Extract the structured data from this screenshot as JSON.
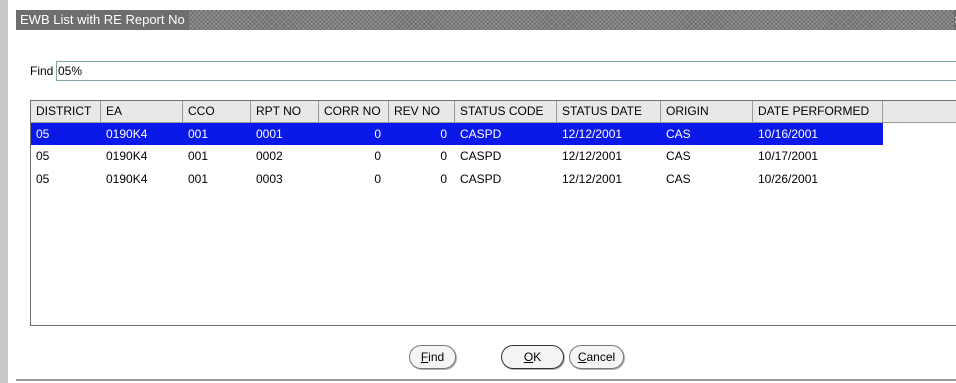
{
  "window": {
    "title": "EWB List with RE Report No",
    "close_glyph": "×"
  },
  "find": {
    "label": "Find",
    "value": "05%"
  },
  "grid": {
    "columns": [
      "DISTRICT",
      "EA",
      "CCO",
      "RPT NO",
      "CORR NO",
      "REV NO",
      "STATUS CODE",
      "STATUS DATE",
      "ORIGIN",
      "DATE PERFORMED"
    ],
    "rows": [
      [
        "05",
        "0190K4",
        "001",
        "0001",
        "0",
        "0",
        "CASPD",
        "12/12/2001",
        "CAS",
        "10/16/2001"
      ],
      [
        "05",
        "0190K4",
        "001",
        "0002",
        "0",
        "0",
        "CASPD",
        "12/12/2001",
        "CAS",
        "10/17/2001"
      ],
      [
        "05",
        "0190K4",
        "001",
        "0003",
        "0",
        "0",
        "CASPD",
        "12/12/2001",
        "CAS",
        "10/26/2001"
      ]
    ],
    "selected_row": 0
  },
  "buttons": {
    "find_mnemonic": "F",
    "find_rest": "ind",
    "ok_mnemonic": "O",
    "ok_rest": "K",
    "cancel_mnemonic": "C",
    "cancel_rest": "ancel"
  },
  "colors": {
    "selection": "#0a18e8",
    "title_bar": "#6e6e6e",
    "find_border": "#7fa3a6"
  }
}
